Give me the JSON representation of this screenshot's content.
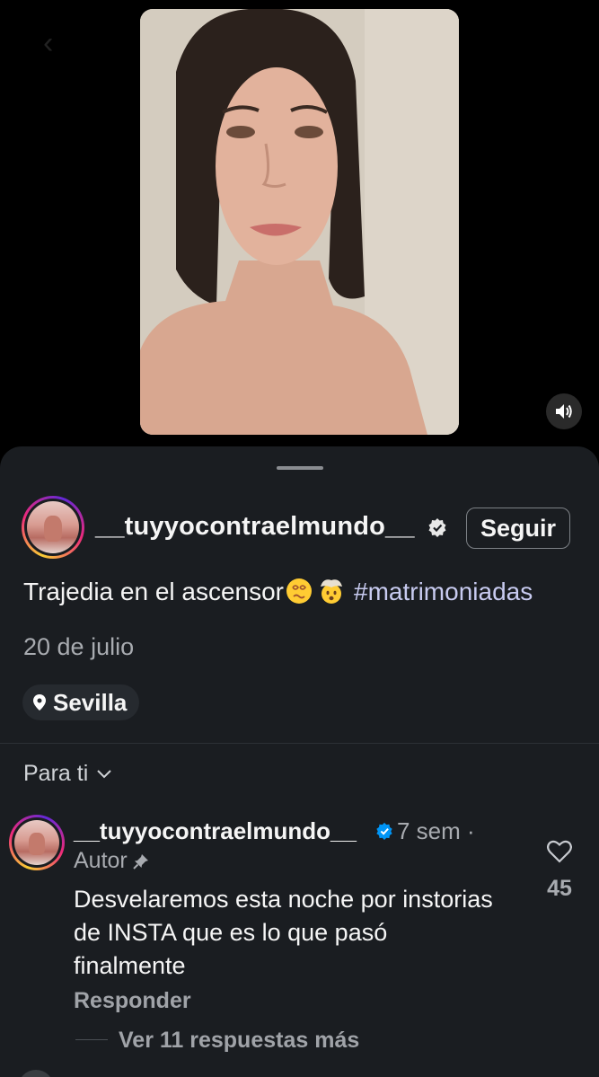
{
  "post": {
    "username": "__tuyyocontraelmundo__",
    "follow_label": "Seguir",
    "caption": "Trajedia en el ascensor",
    "caption_emojis": [
      "dizzy-face-emoji",
      "exploding-head-emoji"
    ],
    "hashtag": "#matrimoniadas",
    "date": "20 de julio",
    "location": "Sevilla"
  },
  "comments_header": {
    "sort_label": "Para ti"
  },
  "comment": {
    "username": "__tuyyocontraelmundo__",
    "time": "7 sem ·",
    "author_label": "Autor",
    "text": "Desvelaremos esta noche por instorias de INSTA que es lo que pasó finalmente",
    "reply_label": "Responder",
    "like_count": "45",
    "more_replies_label": "Ver 11 respuestas más"
  },
  "colors": {
    "background": "#000000",
    "sheet": "#1a1d21",
    "verified": "#0095f6",
    "hashtag": "#c8cbf0",
    "secondary_text": "#a8abb0"
  },
  "icons": [
    "chevron-left-icon",
    "speaker-icon",
    "verified-icon",
    "location-pin-icon",
    "chevron-down-icon",
    "pin-icon",
    "heart-icon"
  ]
}
